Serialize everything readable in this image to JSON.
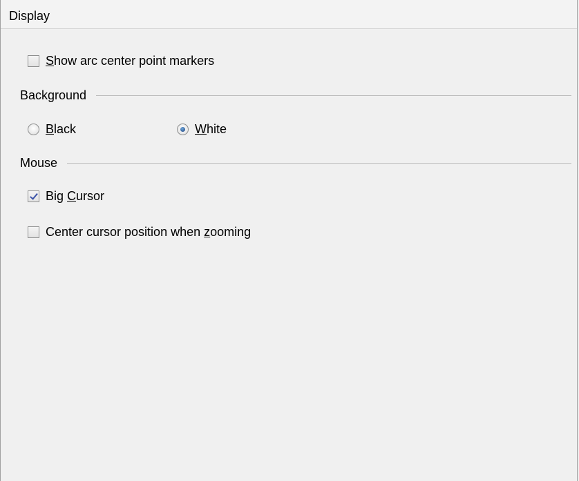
{
  "header": {
    "title": "Display"
  },
  "options": {
    "show_arc_markers": {
      "label_mn": "S",
      "label_rest": "how arc center point markers",
      "checked": false
    }
  },
  "background": {
    "title": "Background",
    "black": {
      "label_mn": "B",
      "label_rest": "lack",
      "selected": false
    },
    "white": {
      "label_mn": "W",
      "label_rest": "hite",
      "selected": true
    }
  },
  "mouse": {
    "title": "Mouse",
    "big_cursor": {
      "label_pre": "Big ",
      "label_mn": "C",
      "label_rest": "ursor",
      "checked": true
    },
    "center_cursor": {
      "label_pre": "Center cursor position when ",
      "label_mn": "z",
      "label_rest": "ooming",
      "checked": false
    }
  }
}
